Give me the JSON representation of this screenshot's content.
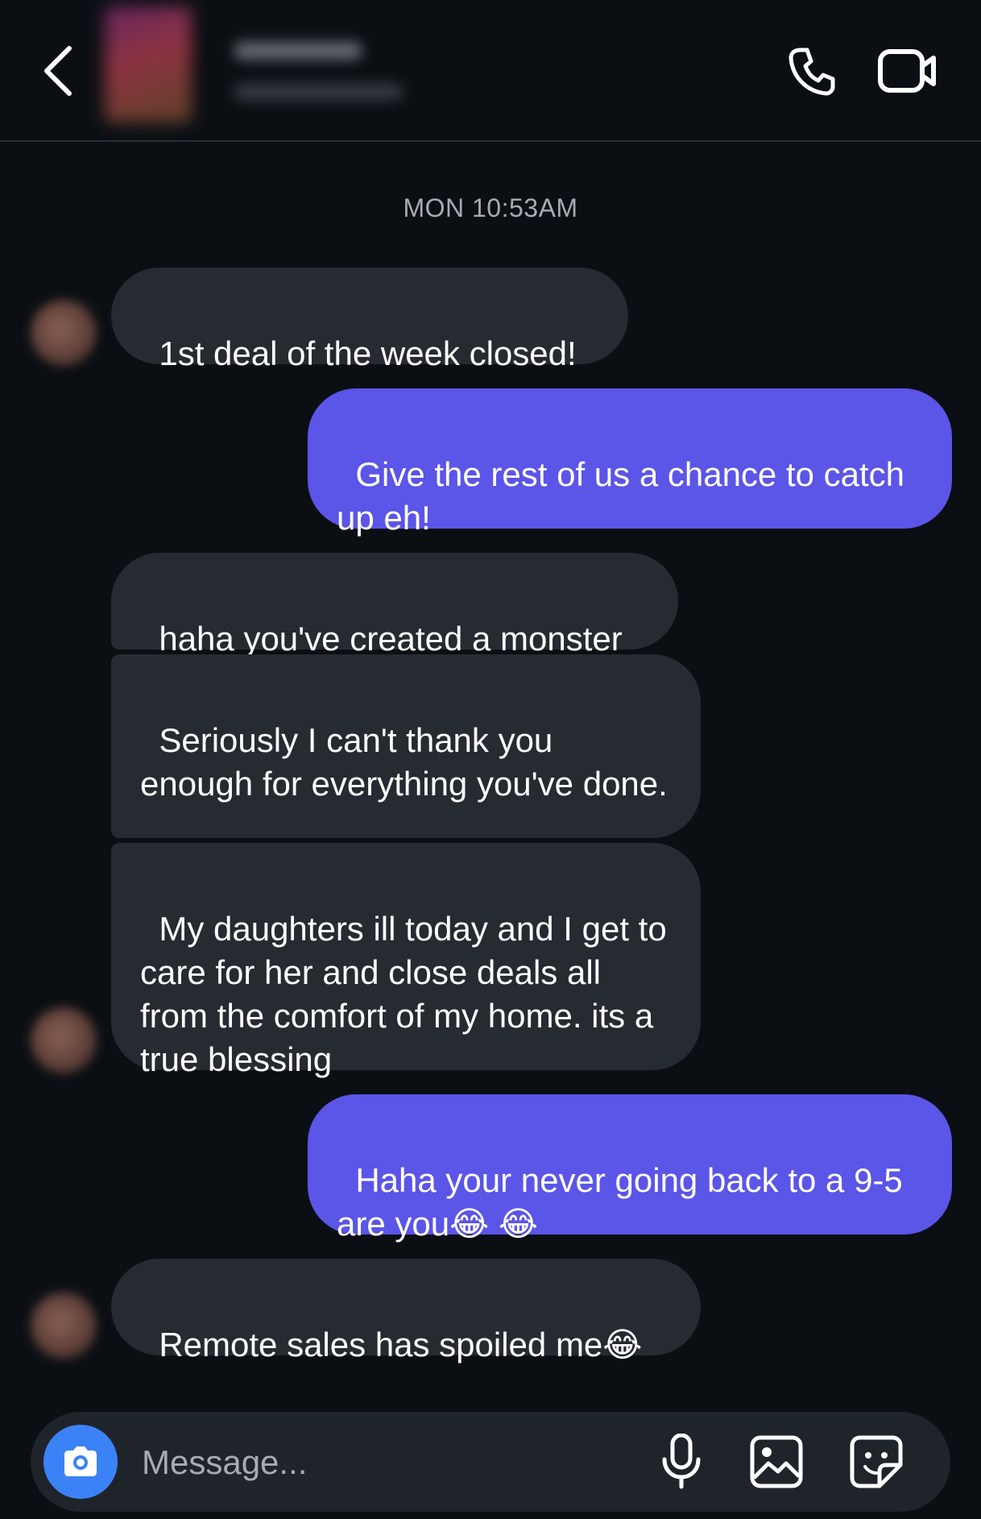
{
  "header": {
    "back_icon": "chevron-left-icon",
    "call_icon": "phone-icon",
    "video_icon": "video-camera-icon"
  },
  "conversation": {
    "timestamp": "MON 10:53AM",
    "messages": [
      {
        "direction": "in",
        "text": "1st deal of the week closed!"
      },
      {
        "direction": "out",
        "text": "Give the rest of us a chance to catch up eh!"
      },
      {
        "direction": "in",
        "text": "haha you've created a monster"
      },
      {
        "direction": "in",
        "text": "Seriously I can't thank you enough for everything you've done."
      },
      {
        "direction": "in",
        "text": "My daughters ill today and I get to care for her and close deals all from the comfort of my home. its a true blessing"
      },
      {
        "direction": "out",
        "text": "Haha your never going back to a 9-5 are you😂 😂"
      },
      {
        "direction": "in",
        "text": "Remote sales has spoiled me😂"
      }
    ]
  },
  "composer": {
    "placeholder": "Message...",
    "camera_icon": "camera-icon",
    "mic_icon": "microphone-icon",
    "gallery_icon": "gallery-icon",
    "sticker_icon": "sticker-icon"
  },
  "colors": {
    "background": "#0b0f14",
    "incoming_bubble": "#262a31",
    "outgoing_bubble": "#5b55e8",
    "camera_button": "#3b82f6"
  }
}
